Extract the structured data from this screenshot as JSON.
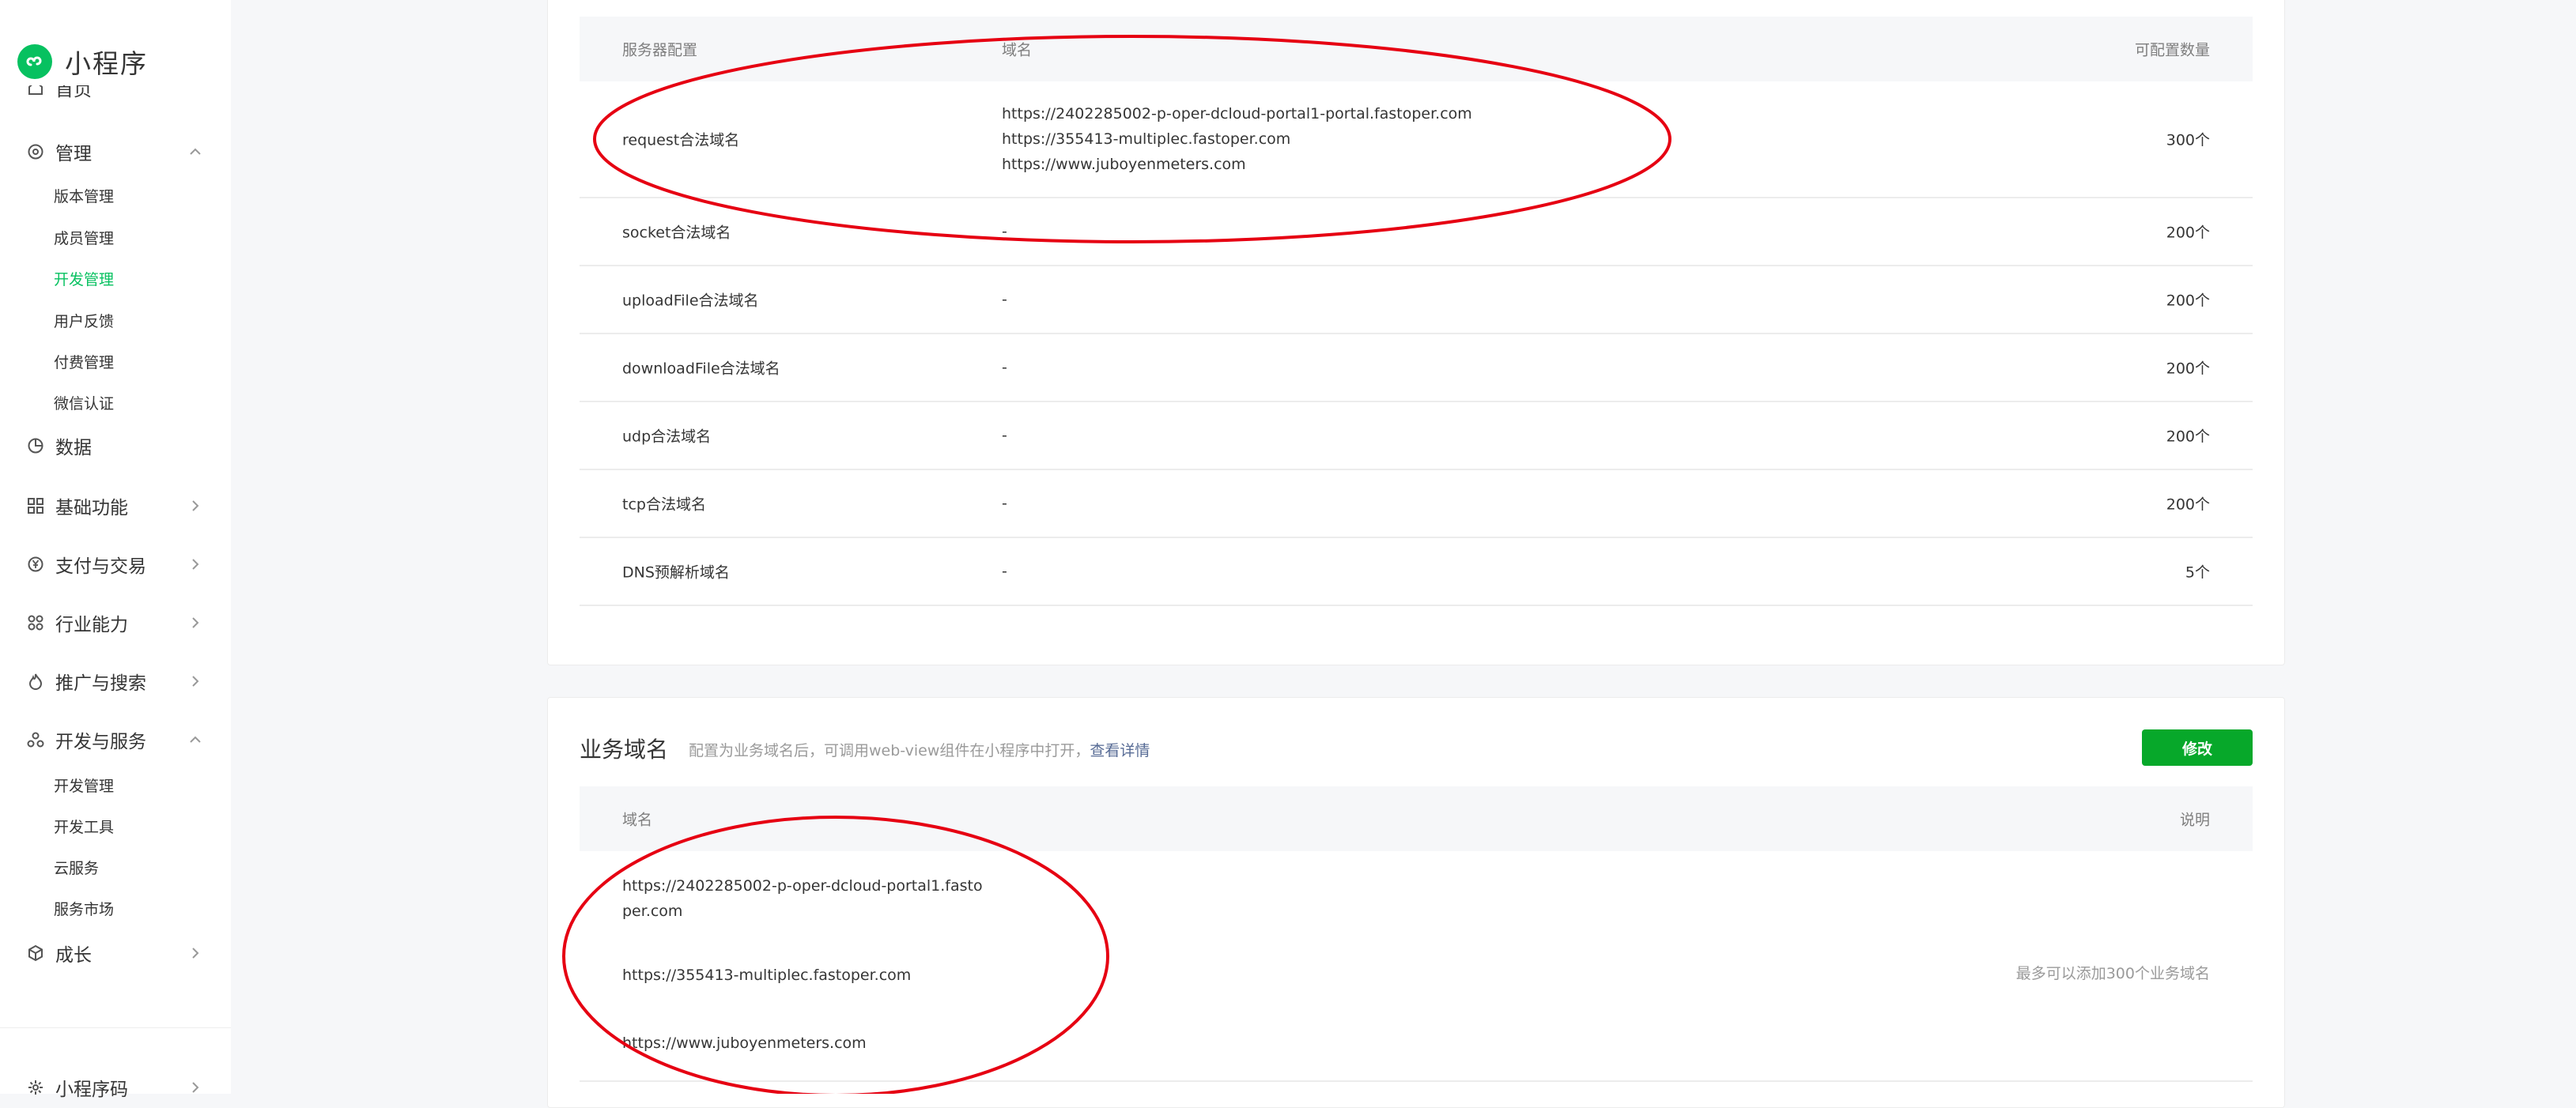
{
  "sidebar": {
    "brand": "小程序",
    "cut_item": "首页",
    "groups": [
      {
        "label": "管理",
        "icon": "settings-icon",
        "expanded": true
      },
      {
        "label": "数据",
        "icon": "pie-chart-icon"
      },
      {
        "label": "基础功能",
        "icon": "grid-icon"
      },
      {
        "label": "支付与交易",
        "icon": "yen-icon"
      },
      {
        "label": "行业能力",
        "icon": "industry-icon"
      },
      {
        "label": "推广与搜索",
        "icon": "flame-icon"
      },
      {
        "label": "开发与服务",
        "icon": "dev-service-icon",
        "expanded": true
      },
      {
        "label": "成长",
        "icon": "growth-icon"
      },
      {
        "label": "小程序码",
        "icon": "qrcode-icon"
      }
    ],
    "manage_items": [
      "版本管理",
      "成员管理",
      "开发管理",
      "用户反馈",
      "付费管理",
      "微信认证"
    ],
    "dev_items": [
      "开发管理",
      "开发工具",
      "云服务",
      "服务市场"
    ],
    "active_item": "开发管理"
  },
  "server_config": {
    "headers": {
      "type": "服务器配置",
      "domain": "域名",
      "quota": "可配置数量"
    },
    "rows": [
      {
        "type": "request合法域名",
        "domains": [
          "https://2402285002-p-oper-dcloud-portal1-portal.fastoper.com",
          "https://355413-multiplec.fastoper.com",
          "https://www.juboyenmeters.com"
        ],
        "quota": "300个"
      },
      {
        "type": "socket合法域名",
        "domains": [
          "-"
        ],
        "quota": "200个"
      },
      {
        "type": "uploadFile合法域名",
        "domains": [
          "-"
        ],
        "quota": "200个"
      },
      {
        "type": "downloadFile合法域名",
        "domains": [
          "-"
        ],
        "quota": "200个"
      },
      {
        "type": "udp合法域名",
        "domains": [
          "-"
        ],
        "quota": "200个"
      },
      {
        "type": "tcp合法域名",
        "domains": [
          "-"
        ],
        "quota": "200个"
      },
      {
        "type": "DNS预解析域名",
        "domains": [
          "-"
        ],
        "quota": "5个"
      }
    ]
  },
  "business_domain": {
    "title": "业务域名",
    "description": "配置为业务域名后，可调用web-view组件在小程序中打开，",
    "details_link": "查看详情",
    "modify_button": "修改",
    "headers": {
      "domain": "域名",
      "note": "说明"
    },
    "domains": [
      "https://2402285002-p-oper-dcloud-portal1.fasto",
      "per.com",
      "https://355413-multiplec.fastoper.com",
      "https://www.juboyenmeters.com"
    ],
    "note": "最多可以添加300个业务域名"
  },
  "colors": {
    "brand_green": "#07c160",
    "button_green": "#07a82a",
    "link_blue": "#576b95",
    "annotation_red": "#e60012"
  }
}
